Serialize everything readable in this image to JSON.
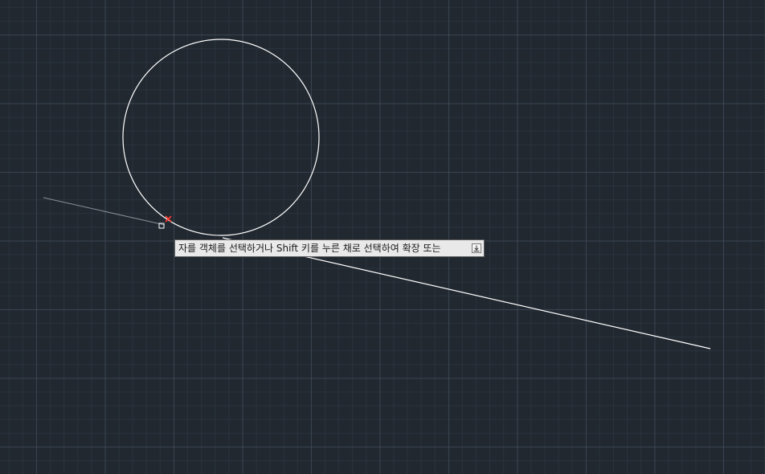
{
  "canvas": {
    "background_color": "#212830",
    "grid_major_color": "#465260",
    "grid_minor_color": "#343e4a",
    "entity_color": "#ffffff",
    "preview_line_color": "#8a8f96",
    "osnap_marker_color": "#ff3b30"
  },
  "entities": {
    "circle": "circle",
    "line": "line",
    "extension_preview": "extension-preview-line"
  },
  "tooltip": {
    "text": "자를 객체를 선택하거나 Shift 키를 누른 채로 선택하여 확장 또는",
    "icon": "arrow-down-icon"
  },
  "cursor": {
    "pickbox": "pickbox",
    "snap_marker": "x-marker-icon"
  }
}
